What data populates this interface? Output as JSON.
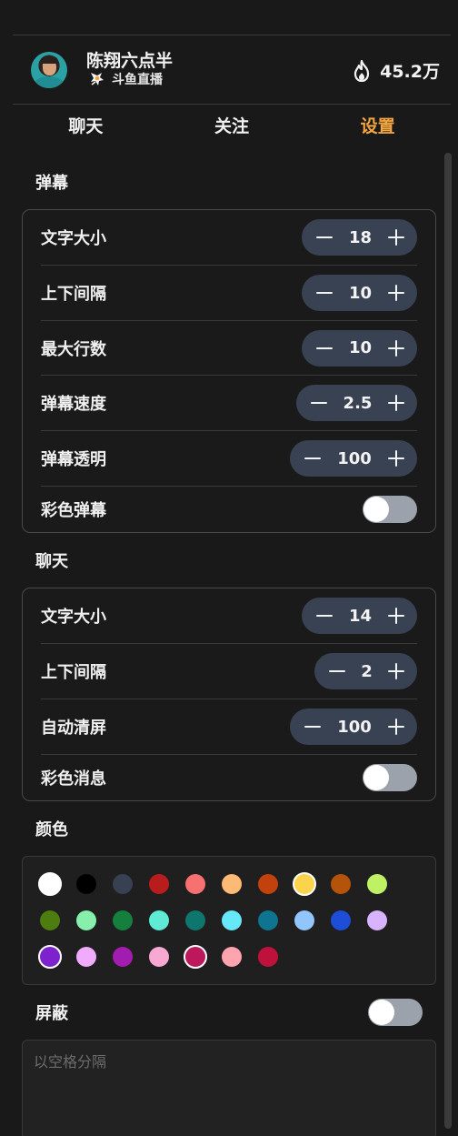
{
  "header": {
    "streamer_name": "陈翔六点半",
    "platform_name": "斗鱼直播",
    "heat": "45.2万",
    "icons": {
      "avatar": "streamer-avatar",
      "platform": "douyu-logo-icon",
      "heat": "flame-icon"
    }
  },
  "tabs": [
    {
      "label": "聊天",
      "active": false
    },
    {
      "label": "关注",
      "active": false
    },
    {
      "label": "设置",
      "active": true
    }
  ],
  "danmaku": {
    "title": "弹幕",
    "font_size": {
      "label": "文字大小",
      "value": "18"
    },
    "line_spacing": {
      "label": "上下间隔",
      "value": "10"
    },
    "max_lines": {
      "label": "最大行数",
      "value": "10"
    },
    "speed": {
      "label": "弹幕速度",
      "value": "2.5"
    },
    "opacity": {
      "label": "弹幕透明",
      "value": "100"
    },
    "colorful": {
      "label": "彩色弹幕",
      "on": false
    }
  },
  "chat": {
    "title": "聊天",
    "font_size": {
      "label": "文字大小",
      "value": "14"
    },
    "line_spacing": {
      "label": "上下间隔",
      "value": "2"
    },
    "auto_clear": {
      "label": "自动清屏",
      "value": "100"
    },
    "colorful": {
      "label": "彩色消息",
      "on": false
    }
  },
  "colors": {
    "title": "颜色",
    "swatches": [
      "#ffffff",
      "#000000",
      "#374151",
      "#b91c1c",
      "#f87171",
      "#fdba74",
      "#c2410c",
      "#fcd34d",
      "#b45309",
      "#bef264",
      "#4d7c0f",
      "#86efac",
      "#15803d",
      "#5eead4",
      "#0f766e",
      "#67e8f9",
      "#0e7490",
      "#93c5fd",
      "#1d4ed8",
      "#d8b4fe",
      "#7e22ce",
      "#f0abfc",
      "#a21caf",
      "#f9a8d4",
      "#be185d",
      "#fda4af",
      "#be123c"
    ],
    "selected_indices": [
      0,
      7,
      20,
      24
    ]
  },
  "block": {
    "title": "屏蔽",
    "on": false,
    "placeholder": "以空格分隔"
  },
  "accent_color": "#f3a640"
}
